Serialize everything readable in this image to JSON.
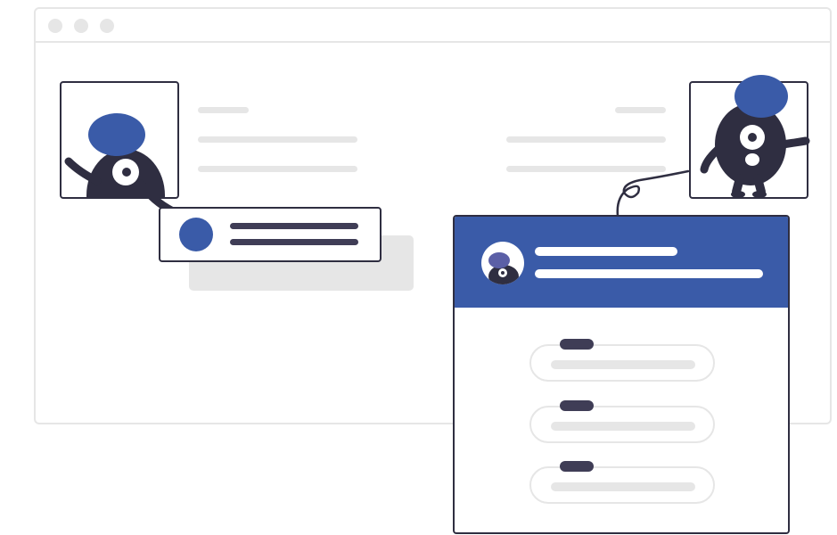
{
  "colors": {
    "accent": "#3a5ba8",
    "dark": "#2f2e41",
    "line_dark": "#3f3d56",
    "placeholder": "#e6e6e6",
    "background": "#ffffff"
  },
  "icons": {
    "window_controls": [
      "window-dot-icon",
      "window-dot-icon",
      "window-dot-icon"
    ],
    "left_character": "one-eyed-monster-icon",
    "right_character": "one-eyed-monster-waving-icon",
    "avatar": "blue-circle-avatar-icon",
    "panel_avatar": "monster-avatar-icon"
  },
  "panel": {
    "option_count": 3
  }
}
